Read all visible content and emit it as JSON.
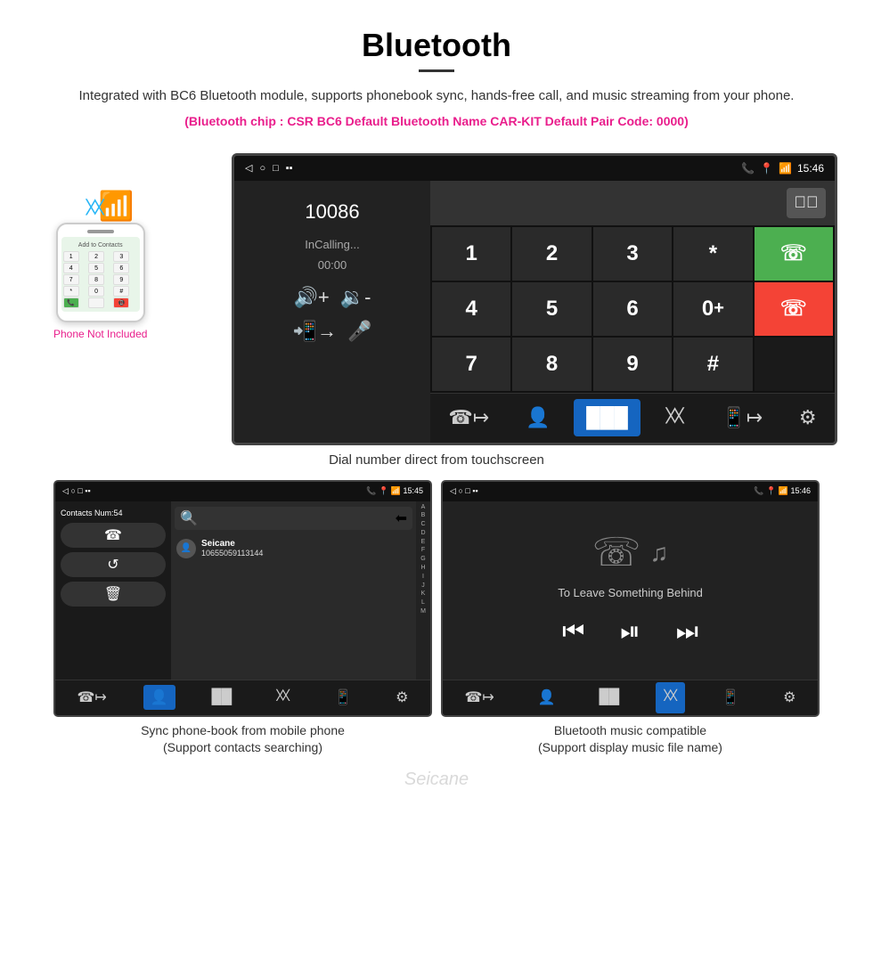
{
  "header": {
    "title": "Bluetooth",
    "description": "Integrated with BC6 Bluetooth module, supports phonebook sync, hands-free call, and music streaming from your phone.",
    "specs": "(Bluetooth chip : CSR BC6    Default Bluetooth Name CAR-KIT    Default Pair Code: 0000)"
  },
  "phone_small": {
    "label": "Add to Contacts",
    "not_included": "Phone Not Included"
  },
  "dial_screen": {
    "statusbar": {
      "left_icons": [
        "◁",
        "○",
        "□",
        "▪▪"
      ],
      "right_icons": [
        "📞",
        "📍",
        "📶",
        "15:46"
      ]
    },
    "number": "10086",
    "calling_label": "InCalling...",
    "calling_time": "00:00",
    "vol_up": "🔊+",
    "vol_down": "🔉-",
    "transfer_icon": "📲",
    "mic_icon": "🎤",
    "keys": [
      "1",
      "2",
      "3",
      "*",
      "",
      "4",
      "5",
      "6",
      "0+",
      "",
      "7",
      "8",
      "9",
      "#",
      ""
    ],
    "caption": "Dial number direct from touchscreen"
  },
  "contacts_screen": {
    "statusbar": {
      "time": "15:45"
    },
    "contacts_num": "Contacts Num:54",
    "search_placeholder": "Search...",
    "contact_name": "Seicane",
    "contact_number": "10655059113144",
    "alpha": [
      "A",
      "B",
      "C",
      "D",
      "E",
      "F",
      "G",
      "H",
      "I",
      "J",
      "K",
      "L",
      "M"
    ],
    "captions": [
      "Sync phone-book from mobile phone",
      "(Support contacts searching)"
    ]
  },
  "music_screen": {
    "statusbar": {
      "time": "15:46"
    },
    "song_title": "To Leave Something Behind",
    "captions": [
      "Bluetooth music compatible",
      "(Support display music file name)"
    ]
  },
  "watermark": "Seicane"
}
